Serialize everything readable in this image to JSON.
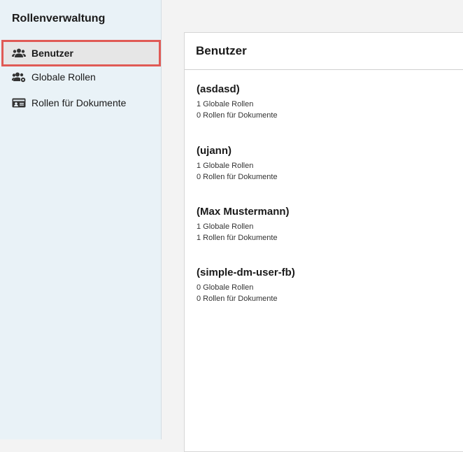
{
  "sidebar": {
    "title": "Rollenverwaltung",
    "items": [
      {
        "label": "Benutzer",
        "icon": "users-icon",
        "active": true
      },
      {
        "label": "Globale Rollen",
        "icon": "users-cog-icon",
        "active": false
      },
      {
        "label": "Rollen für Dokumente",
        "icon": "id-card-icon",
        "active": false
      }
    ]
  },
  "main": {
    "title": "Benutzer",
    "users": [
      {
        "name": "(asdasd)",
        "global": "1 Globale Rollen",
        "docs": "0 Rollen für Dokumente"
      },
      {
        "name": "(ujann)",
        "global": "1 Globale Rollen",
        "docs": "0 Rollen für Dokumente"
      },
      {
        "name": "(Max Mustermann)",
        "global": "1 Globale Rollen",
        "docs": "1 Rollen für Dokumente"
      },
      {
        "name": "(simple-dm-user-fb)",
        "global": "0 Globale Rollen",
        "docs": "0 Rollen für Dokumente"
      }
    ]
  },
  "colors": {
    "sidebar_bg": "#e9f2f7",
    "highlight_border": "#e05a55"
  }
}
